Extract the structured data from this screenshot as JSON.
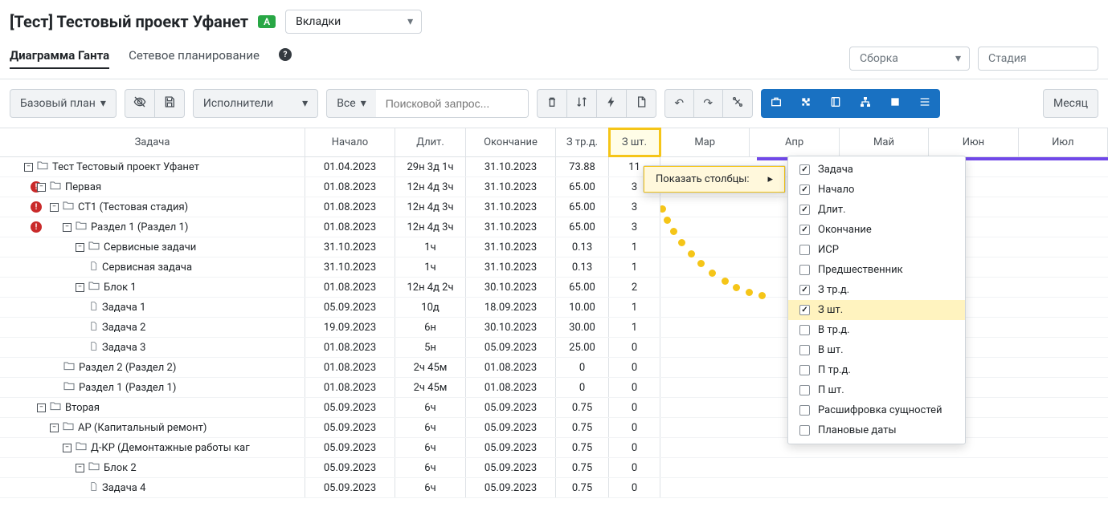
{
  "header": {
    "title": "[Тест] Тестовый проект Уфанет",
    "badge": "A",
    "tabs_label": "Вкладки"
  },
  "subnav": {
    "tab_gantt": "Диаграмма Ганта",
    "tab_network": "Сетевое планирование",
    "assembly_placeholder": "Сборка",
    "stage_placeholder": "Стадия"
  },
  "toolbar": {
    "baseline": "Базовый план",
    "executors": "Исполнители",
    "all": "Все",
    "search_placeholder": "Поисковой запрос...",
    "month": "Месяц"
  },
  "columns": {
    "task": "Задача",
    "start": "Начало",
    "duration": "Длит.",
    "end": "Окончание",
    "trd": "З тр.д.",
    "sht": "З шт."
  },
  "months": [
    "Мар",
    "Апр",
    "Май",
    "Июн",
    "Июл"
  ],
  "rows": [
    {
      "indent": 0,
      "warn": false,
      "expand": "-",
      "icon": "folder",
      "name": "Тест Тестовый проект Уфанет",
      "start": "01.04.2023",
      "dur": "29н 3д 1ч",
      "end": "31.10.2023",
      "trd": "73.88",
      "sht": "11"
    },
    {
      "indent": 1,
      "warn": true,
      "expand": "-",
      "icon": "folder",
      "name": "Первая",
      "start": "01.08.2023",
      "dur": "12н 4д 3ч",
      "end": "31.10.2023",
      "trd": "65.00",
      "sht": "3"
    },
    {
      "indent": 2,
      "warn": true,
      "expand": "-",
      "icon": "folder",
      "name": "СТ1 (Тестовая стадия)",
      "start": "01.08.2023",
      "dur": "12н 4д 3ч",
      "end": "31.10.2023",
      "trd": "65.00",
      "sht": "3"
    },
    {
      "indent": 3,
      "warn": true,
      "expand": "-",
      "icon": "folder",
      "name": "Раздел 1 (Раздел 1)",
      "start": "01.08.2023",
      "dur": "12н 4д 3ч",
      "end": "31.10.2023",
      "trd": "65.00",
      "sht": "3"
    },
    {
      "indent": 4,
      "warn": false,
      "expand": "-",
      "icon": "folder",
      "name": "Сервисные задачи",
      "start": "31.10.2023",
      "dur": "1ч",
      "end": "31.10.2023",
      "trd": "0.13",
      "sht": "1"
    },
    {
      "indent": 5,
      "warn": false,
      "expand": "",
      "icon": "file",
      "name": "Сервисная задача",
      "start": "31.10.2023",
      "dur": "1ч",
      "end": "31.10.2023",
      "trd": "0.13",
      "sht": "1"
    },
    {
      "indent": 4,
      "warn": false,
      "expand": "-",
      "icon": "folder",
      "name": "Блок 1",
      "start": "01.08.2023",
      "dur": "12н 4д 2ч",
      "end": "30.10.2023",
      "trd": "65.00",
      "sht": "2"
    },
    {
      "indent": 5,
      "warn": false,
      "expand": "",
      "icon": "file",
      "name": "Задача 1",
      "start": "05.09.2023",
      "dur": "10д",
      "end": "18.09.2023",
      "trd": "10.00",
      "sht": "1"
    },
    {
      "indent": 5,
      "warn": false,
      "expand": "",
      "icon": "file",
      "name": "Задача 2",
      "start": "19.09.2023",
      "dur": "6н",
      "end": "30.10.2023",
      "trd": "30.00",
      "sht": "1"
    },
    {
      "indent": 5,
      "warn": false,
      "expand": "",
      "icon": "file",
      "name": "Задача 3",
      "start": "01.08.2023",
      "dur": "5н",
      "end": "05.09.2023",
      "trd": "25.00",
      "sht": "0"
    },
    {
      "indent": 3,
      "warn": false,
      "expand": "",
      "icon": "folder",
      "name": "Раздел 2 (Раздел 2)",
      "start": "01.08.2023",
      "dur": "2ч 45м",
      "end": "01.08.2023",
      "trd": "0",
      "sht": "0"
    },
    {
      "indent": 3,
      "warn": false,
      "expand": "",
      "icon": "folder",
      "name": "Раздел 1 (Раздел 1)",
      "start": "01.08.2023",
      "dur": "2ч 45м",
      "end": "01.08.2023",
      "trd": "0",
      "sht": "0"
    },
    {
      "indent": 1,
      "warn": false,
      "expand": "-",
      "icon": "folder",
      "name": "Вторая",
      "start": "05.09.2023",
      "dur": "6ч",
      "end": "05.09.2023",
      "trd": "0.75",
      "sht": "0"
    },
    {
      "indent": 2,
      "warn": false,
      "expand": "-",
      "icon": "folder",
      "name": "АР (Капитальный ремонт)",
      "start": "05.09.2023",
      "dur": "6ч",
      "end": "05.09.2023",
      "trd": "0.75",
      "sht": "0"
    },
    {
      "indent": 3,
      "warn": false,
      "expand": "-",
      "icon": "folder",
      "name": "Д-КР (Демонтажные работы каг",
      "start": "05.09.2023",
      "dur": "6ч",
      "end": "05.09.2023",
      "trd": "0.75",
      "sht": "0"
    },
    {
      "indent": 4,
      "warn": false,
      "expand": "-",
      "icon": "folder",
      "name": "Блок 2",
      "start": "05.09.2023",
      "dur": "6ч",
      "end": "05.09.2023",
      "trd": "0.75",
      "sht": "0"
    },
    {
      "indent": 5,
      "warn": false,
      "expand": "",
      "icon": "file",
      "name": "Задача 4",
      "start": "05.09.2023",
      "dur": "6ч",
      "end": "05.09.2023",
      "trd": "0.75",
      "sht": "0"
    }
  ],
  "context_menu": {
    "header": "Показать столбцы:",
    "items": [
      {
        "label": "Задача",
        "checked": true
      },
      {
        "label": "Начало",
        "checked": true
      },
      {
        "label": "Длит.",
        "checked": true
      },
      {
        "label": "Окончание",
        "checked": true
      },
      {
        "label": "ИСР",
        "checked": false
      },
      {
        "label": "Предшественник",
        "checked": false
      },
      {
        "label": "З тр.д.",
        "checked": true
      },
      {
        "label": "З шт.",
        "checked": true,
        "hl": true
      },
      {
        "label": "В тр.д.",
        "checked": false
      },
      {
        "label": "В шт.",
        "checked": false
      },
      {
        "label": "П тр.д.",
        "checked": false
      },
      {
        "label": "П шт.",
        "checked": false
      },
      {
        "label": "Расшифровка сущностей",
        "checked": false
      },
      {
        "label": "Плановые даты",
        "checked": false
      }
    ]
  }
}
